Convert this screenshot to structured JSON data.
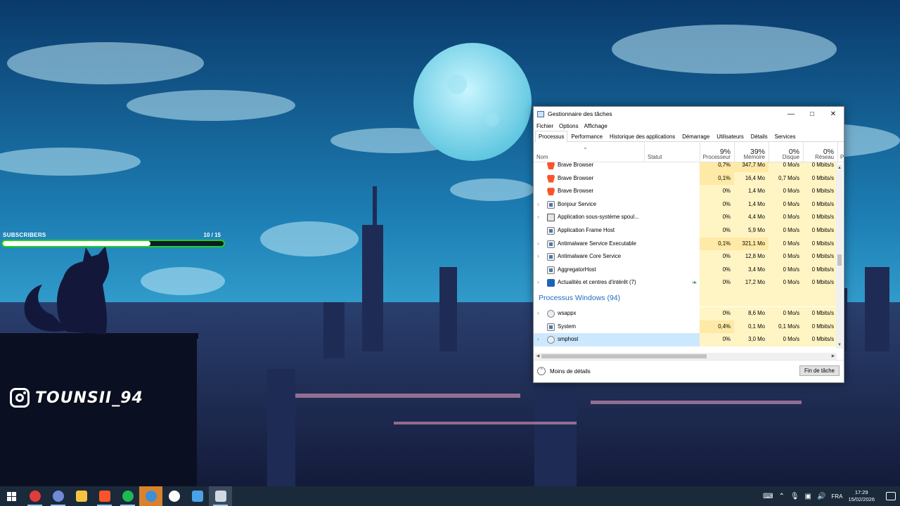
{
  "overlay": {
    "subscribers_label": "SUBSCRIBERS",
    "subscribers_count": "10  / 15",
    "subscribers_progress": 0.67,
    "instagram_handle": "TOUNSII_94"
  },
  "taskmgr": {
    "title": "Gestionnaire des tâches",
    "menu": [
      "Fichier",
      "Options",
      "Affichage"
    ],
    "tabs": [
      "Processus",
      "Performance",
      "Historique des applications",
      "Démarrage",
      "Utilisateurs",
      "Détails",
      "Services"
    ],
    "active_tab": "Processus",
    "columns": {
      "name": "Nom",
      "status": "Statut",
      "cpu": {
        "label": "Processeur",
        "pct": "9%"
      },
      "memory": {
        "label": "Mémoire",
        "pct": "39%"
      },
      "disk": {
        "label": "Disque",
        "pct": "0%"
      },
      "network": {
        "label": "Réseau",
        "pct": "0%"
      },
      "extra": "P"
    },
    "rows": [
      {
        "name": "Brave Browser",
        "icon": "brave-icon",
        "expandable": false,
        "cpu": "0,7%",
        "mem": "347,7 Mo",
        "disk": "0 Mo/s",
        "net": "0 Mbits/s",
        "partial": true
      },
      {
        "name": "Brave Browser",
        "icon": "brave-icon",
        "expandable": false,
        "cpu": "0,1%",
        "mem": "16,4 Mo",
        "disk": "0,7 Mo/s",
        "net": "0 Mbits/s"
      },
      {
        "name": "Brave Browser",
        "icon": "brave-icon",
        "expandable": false,
        "cpu": "0%",
        "mem": "1,4 Mo",
        "disk": "0 Mo/s",
        "net": "0 Mbits/s"
      },
      {
        "name": "Bonjour Service",
        "icon": "service-icon",
        "expandable": true,
        "cpu": "0%",
        "mem": "1,4 Mo",
        "disk": "0 Mo/s",
        "net": "0 Mbits/s"
      },
      {
        "name": "Application sous-système spoul...",
        "icon": "printer-icon",
        "expandable": true,
        "cpu": "0%",
        "mem": "4,4 Mo",
        "disk": "0 Mo/s",
        "net": "0 Mbits/s"
      },
      {
        "name": "Application Frame Host",
        "icon": "service-icon",
        "expandable": false,
        "cpu": "0%",
        "mem": "5,9 Mo",
        "disk": "0 Mo/s",
        "net": "0 Mbits/s"
      },
      {
        "name": "Antimalware Service Executable",
        "icon": "service-icon",
        "expandable": true,
        "cpu": "0,1%",
        "mem": "321,1 Mo",
        "disk": "0 Mo/s",
        "net": "0 Mbits/s"
      },
      {
        "name": "Antimalware Core Service",
        "icon": "service-icon",
        "expandable": true,
        "cpu": "0%",
        "mem": "12,8 Mo",
        "disk": "0 Mo/s",
        "net": "0 Mbits/s"
      },
      {
        "name": "AggregatorHost",
        "icon": "service-icon",
        "expandable": false,
        "cpu": "0%",
        "mem": "3,4 Mo",
        "disk": "0 Mo/s",
        "net": "0 Mbits/s"
      },
      {
        "name": "Actualités et centres d'intérêt (7)",
        "icon": "news-icon",
        "expandable": true,
        "status_leaf": true,
        "cpu": "0%",
        "mem": "17,2 Mo",
        "disk": "0 Mo/s",
        "net": "0 Mbits/s"
      }
    ],
    "group_title": "Processus Windows (94)",
    "windows_rows": [
      {
        "name": "wsappx",
        "icon": "gear-icon",
        "expandable": true,
        "cpu": "0%",
        "mem": "8,6 Mo",
        "disk": "0 Mo/s",
        "net": "0 Mbits/s"
      },
      {
        "name": "System",
        "icon": "service-icon",
        "expandable": false,
        "cpu": "0,4%",
        "mem": "0,1 Mo",
        "disk": "0,1 Mo/s",
        "net": "0 Mbits/s"
      },
      {
        "name": "smphost",
        "icon": "gear-icon",
        "expandable": true,
        "selected": true,
        "cpu": "0%",
        "mem": "3,0 Mo",
        "disk": "0 Mo/s",
        "net": "0 Mbits/s"
      }
    ],
    "less_details": "Moins de détails",
    "end_task": "Fin de tâche"
  },
  "taskbar": {
    "apps": [
      {
        "name": "obs-icon",
        "color": "#e23b3b"
      },
      {
        "name": "discord-icon",
        "color": "#7289da"
      },
      {
        "name": "file-explorer-icon",
        "color": "#f5c342"
      },
      {
        "name": "brave-icon",
        "color": "#fb542b"
      },
      {
        "name": "spotify-icon",
        "color": "#1db954"
      },
      {
        "name": "browser-globe-icon",
        "color": "#3d8fd9"
      },
      {
        "name": "settings-gear-icon",
        "color": "#ffffff"
      },
      {
        "name": "remote-desktop-icon",
        "color": "#4aa3e8"
      },
      {
        "name": "task-manager-icon",
        "color": "#cfd8e3"
      }
    ],
    "language": "FRA",
    "time": "17:29",
    "date": "15/02/2026"
  }
}
